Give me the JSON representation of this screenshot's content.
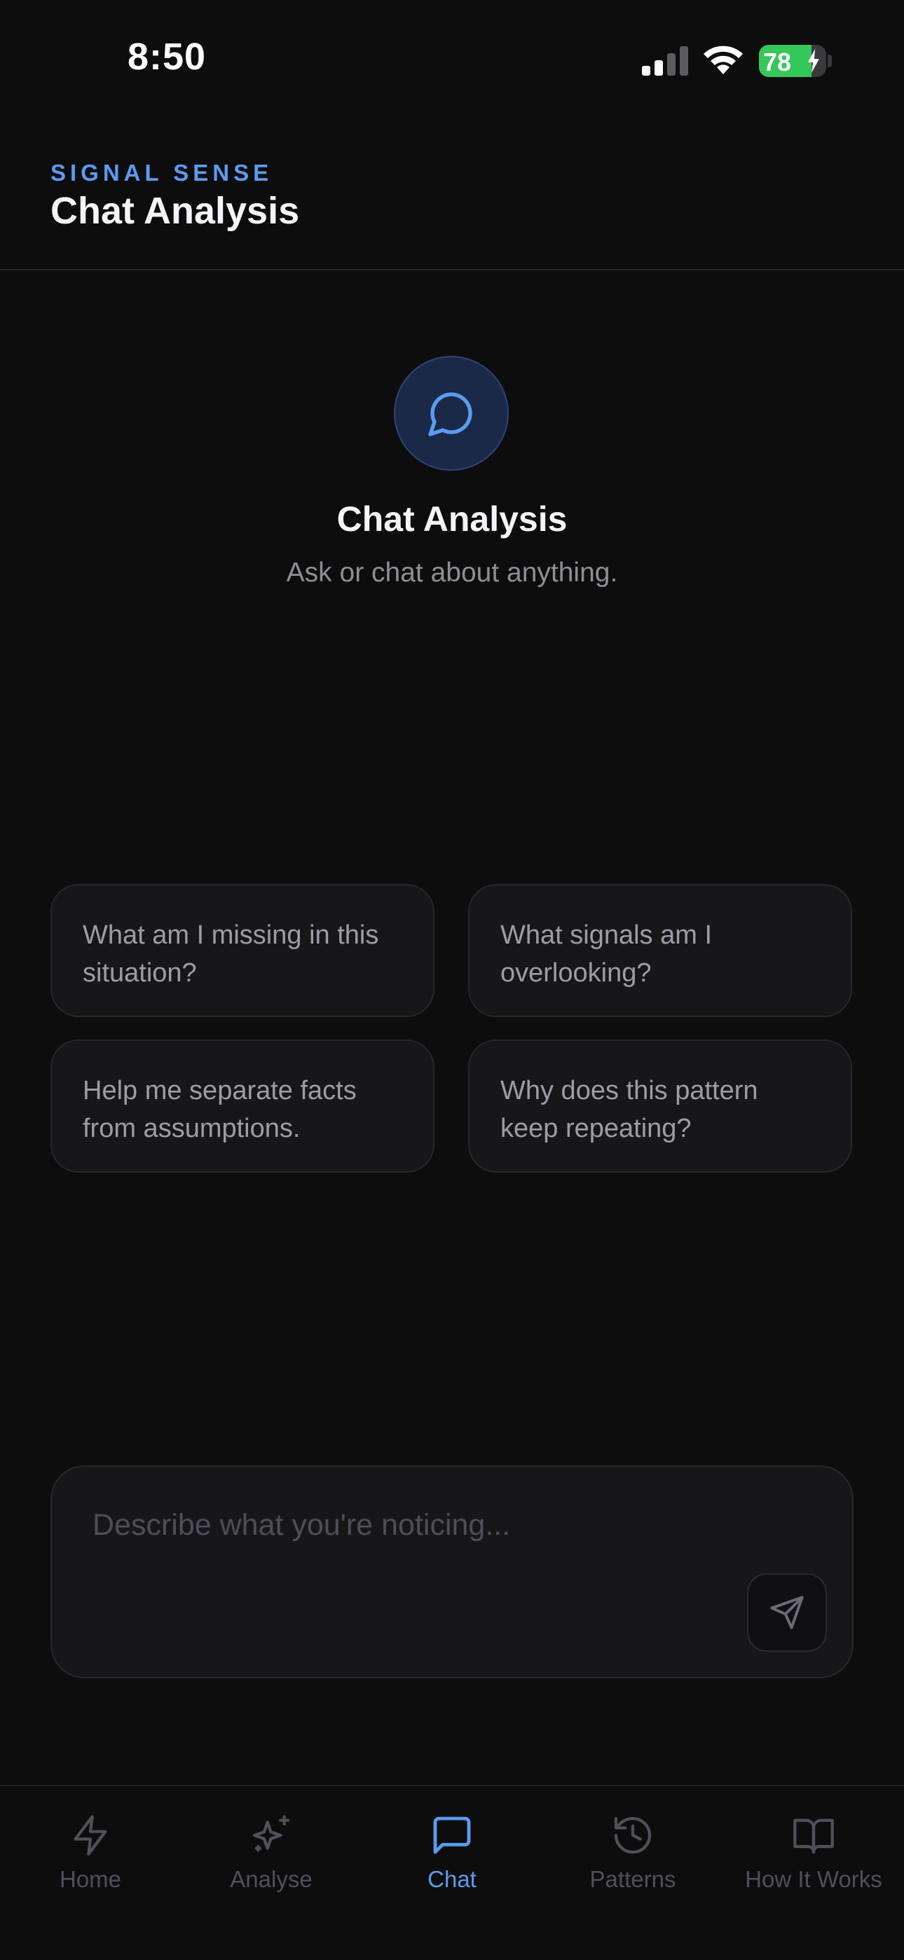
{
  "status_bar": {
    "time": "8:50",
    "battery": "78",
    "battery_level": 0.78
  },
  "header": {
    "eyebrow": "SIGNAL SENSE",
    "title": "Chat Analysis"
  },
  "hero": {
    "icon": "chat-bubble-icon",
    "title": "Chat Analysis",
    "subtitle": "Ask or chat about anything."
  },
  "suggestions": [
    {
      "text": "What am I missing in this situation?"
    },
    {
      "text": "What signals am I overlooking?"
    },
    {
      "text": "Help me separate facts from assumptions."
    },
    {
      "text": "Why does this pattern keep repeating?"
    }
  ],
  "composer": {
    "placeholder": "Describe what you're noticing...",
    "send_icon": "send-icon"
  },
  "tabs": [
    {
      "label": "Home",
      "icon": "lightning-icon",
      "active": false
    },
    {
      "label": "Analyse",
      "icon": "sparkle-icon",
      "active": false
    },
    {
      "label": "Chat",
      "icon": "chat-bubble-icon",
      "active": true
    },
    {
      "label": "Patterns",
      "icon": "history-icon",
      "active": false
    },
    {
      "label": "How It Works",
      "icon": "book-icon",
      "active": false
    }
  ],
  "colors": {
    "accent": "#5a9cf0",
    "background": "#0d0d0e",
    "card": "#17171a",
    "battery": "#34c759"
  }
}
